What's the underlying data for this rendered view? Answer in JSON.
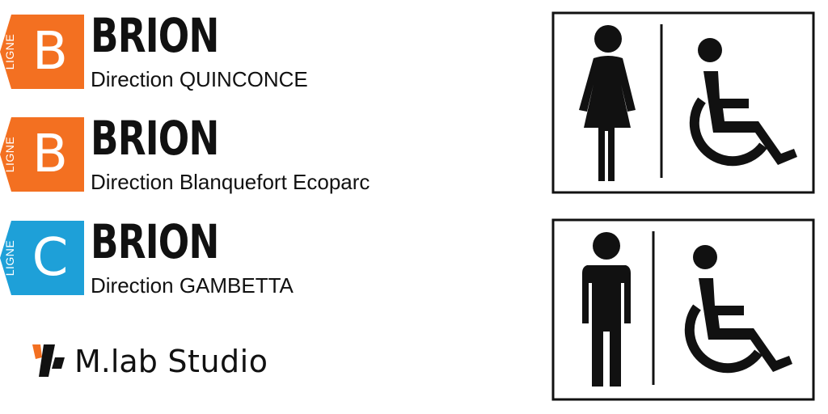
{
  "signs": [
    {
      "ligne": "LIGNE",
      "letter": "B",
      "stop": "BRION",
      "direction": "Direction QUINCONCE",
      "color": "#F37021"
    },
    {
      "ligne": "LIGNE",
      "letter": "B",
      "stop": "BRION",
      "direction": "Direction Blanquefort Ecoparc",
      "color": "#F37021"
    },
    {
      "ligne": "LIGNE",
      "letter": "C",
      "stop": "BRION",
      "direction": "Direction GAMBETTA",
      "color": "#1EA0D8"
    }
  ],
  "brand": {
    "name": "M.lab",
    "suffix": " Studio",
    "accent": "#F37021",
    "icon": "mlab-logo-icon"
  },
  "restroom_signs": [
    {
      "figure": "woman-icon",
      "accessibility": "wheelchair-icon"
    },
    {
      "figure": "man-icon",
      "accessibility": "wheelchair-icon"
    }
  ]
}
